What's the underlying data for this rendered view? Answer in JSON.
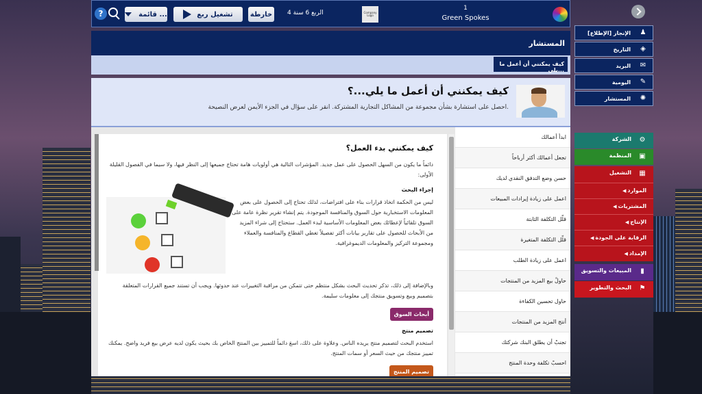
{
  "topbar": {
    "menu_label": "قائمة ...",
    "run_label": "تشغيل ربع",
    "map_label": "خارطة",
    "quarter_label": "الربع 6 سنة 4",
    "logo_text": "Company Logo",
    "team_number": "1",
    "team_name": "Green Spokes"
  },
  "header": {
    "title": "المستشار",
    "crumb": "كيف يمكنني أن أعمل ما يلي..."
  },
  "hero": {
    "title": "كيف يمكنني أن أعمل ما يلي...؟",
    "subtitle": "احصل على استشارة بشأن مجموعة من المشاكل التجارية المشتركة. انقر على سؤال في الجزء الأيمن لعرض النصيحة."
  },
  "article": {
    "title": "كيف يمكنني بدء العمل؟",
    "intro": "دائماً ما يكون من السهل الحصول على عمل جديد. المؤشرات التالية هي أولويات هامة تحتاج جميعها إلى النظر فيها، ولا سيما في الفصول القليلة الأولى:",
    "section1_heading": "إجراء البحث",
    "section1_text": "ليس من الحكمة اتخاذ قرارات بناء على افتراضات، لذلك تحتاج إلى الحصول على بعض المعلومات الاستخبارية حول السوق والمنافسة الموجودة. يتم إنشاء تقرير نظرة عامة على السوق تلقائياً لإعطائك بعض المعلومات الأساسية لبدء العمل. ستحتاج إلى شراء المزيد من الأبحاث للحصول على تقارير بيانات أكثر تفصيلاً تغطي القطاع والمنافسة والعملاء ومجموعة التركيز والمعلومات الديموغرافية.",
    "section1_more": "وبالإضافة إلى ذلك، تذكر تحديث البحث بشكل منتظم حتى تتمكن من مراقبة التغييرات عند حدوثها. ويجب أن تستند جميع القرارات المتعلقة بتصميم وبيع وتسويق منتجك إلى معلومات سليمة.",
    "tag1": "أبحاث السوق",
    "section2_heading": "تصميم منتج",
    "section2_text": "استخدم البحث لتصميم منتج يريده الناس. وعلاوة على ذلك، اسعَ دائماً للتمييز بين المنتج الخاص بك بحيث يكون لديه عرض بيع فريد واضح. يمكنك تمييز منتجك من حيث السعر أو سمات المنتج.",
    "tag2": "تصميم المنتج"
  },
  "faq": [
    "ابدأ أعمالك",
    "تجعل أعمالك أكثر أرباحاً",
    "حسن وضع التدفق النقدي لديك",
    "اعمل على زيادة إيرادات المبيعات",
    "قلّل التكلفة الثابتة",
    "قلّل التكلفة المتغيرة",
    "اعمل على زيادة الطلب",
    "حاولْ بيع المزيد من المنتجات",
    "حاول تحسين الكفاءة",
    "أنتج المزيد من المنتجات",
    "تجنبْ أن يطلق البنك شركتك",
    "احسبْ تكلفة وحدة المنتج"
  ],
  "nav": {
    "items": [
      {
        "label": "الإنجاز [الإطلاع]",
        "icon": "people-icon"
      },
      {
        "label": "التاريخ",
        "icon": "history-icon"
      },
      {
        "label": "البريد",
        "icon": "mail-icon"
      },
      {
        "label": "اليومية",
        "icon": "pencil-icon"
      },
      {
        "label": "المستشار",
        "icon": "lightbulb-icon"
      }
    ],
    "company": "الشركة",
    "org": "المنظمة",
    "operations": "التشغيل",
    "operations_sub": [
      "الموارد",
      "المشتريات",
      "الإنتاج",
      "الرقابة على الجودة",
      "الإمداد"
    ],
    "sales": "المبيعات والتسويق",
    "research": "البحث والتطوير"
  },
  "colors": {
    "navy": "#0b2560",
    "company_green": "#1b7a6e",
    "org_green": "#2a8a2a",
    "ops_red": "#b8141c",
    "sales_purple": "#5a2a8a",
    "research_red": "#c8161e"
  }
}
